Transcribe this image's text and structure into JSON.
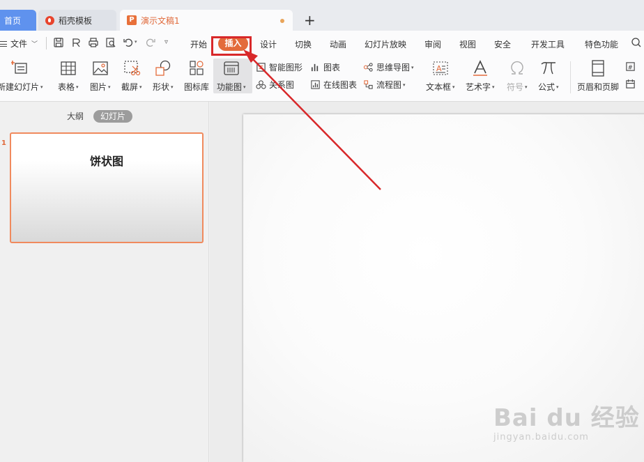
{
  "tabs": {
    "home": "首页",
    "template": "稻壳模板",
    "document": "演示文稿1"
  },
  "menu": {
    "file": "文件",
    "items": [
      "开始",
      "插入",
      "设计",
      "切换",
      "动画",
      "幻灯片放映",
      "审阅",
      "视图",
      "安全",
      "开发工具",
      "特色功能"
    ],
    "active": "插入"
  },
  "ribbon": {
    "new_slide": "新建幻灯片",
    "table": "表格",
    "picture": "图片",
    "screenshot": "截屏",
    "shape": "形状",
    "icon_library": "图标库",
    "function_chart": "功能图",
    "smart_shape": "智能图形",
    "relation": "关系图",
    "chart": "图表",
    "online_chart": "在线图表",
    "mind_map": "思维导图",
    "flowchart": "流程图",
    "textbox": "文本框",
    "wordart": "艺术字",
    "symbol": "符号",
    "formula": "公式",
    "header_footer": "页眉和页脚"
  },
  "leftpanel": {
    "outline": "大纲",
    "slides": "幻灯片",
    "slide_number": "1",
    "slide_title": "饼状图"
  },
  "watermark": {
    "logo": "Bai du 经验",
    "url": "jingyan.baidu.com"
  },
  "colors": {
    "accent": "#e36b3b",
    "highlight": "#d8282a",
    "home_tab": "#5f92ee"
  }
}
